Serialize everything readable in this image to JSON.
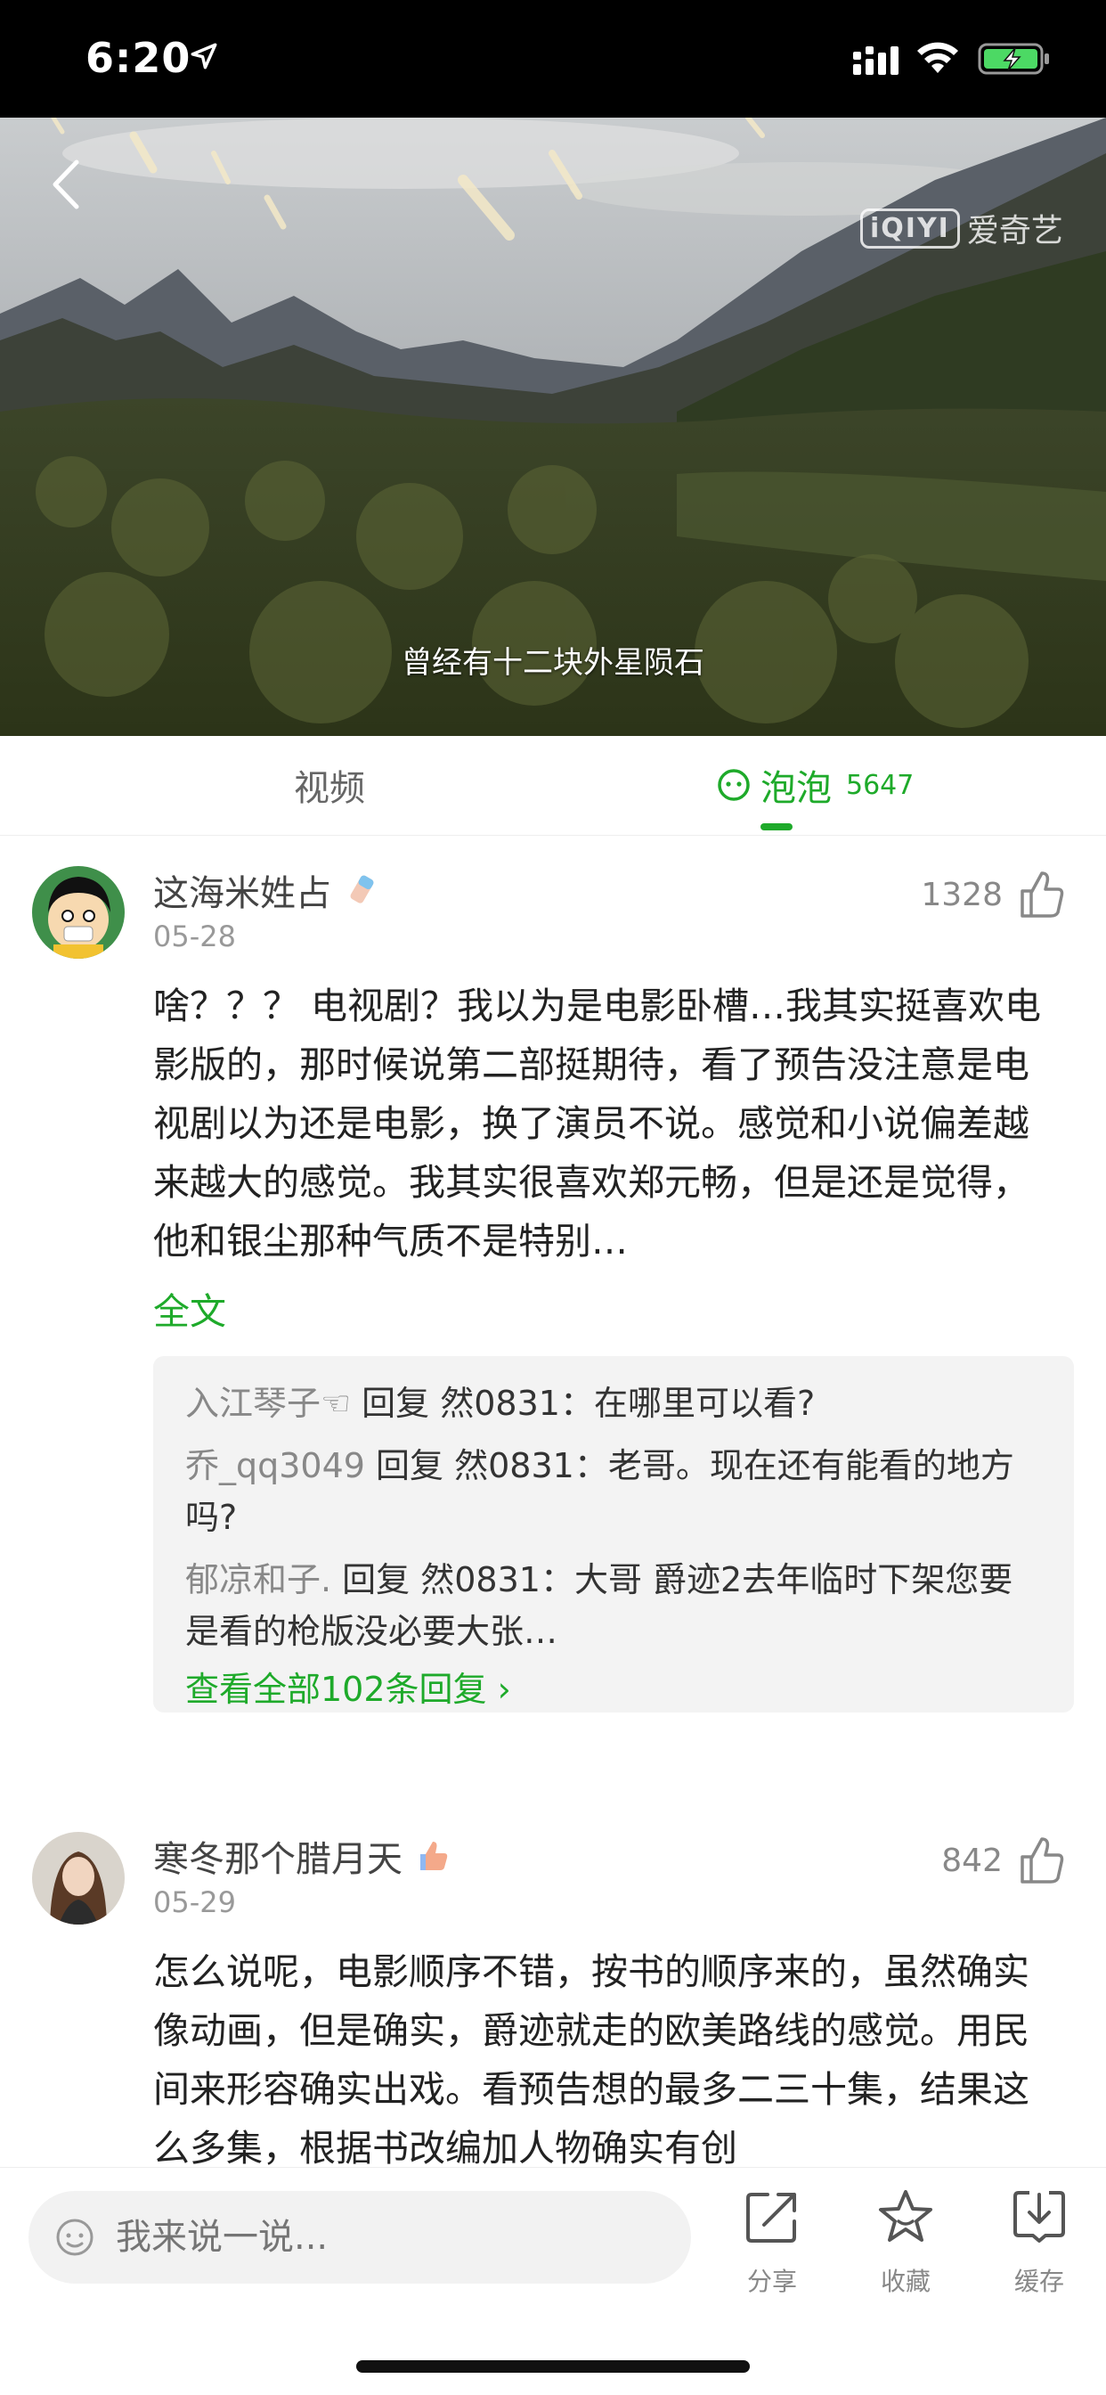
{
  "status": {
    "time": "6:20"
  },
  "video": {
    "logo_mark": "iQIYI",
    "logo_text": "爱奇艺",
    "subtitle": "曾经有十二块外星陨石"
  },
  "tabs": {
    "video_label": "视频",
    "bubble_label": "泡泡",
    "bubble_count": "5647"
  },
  "comments": [
    {
      "username": "这海米姓占",
      "date": "05-28",
      "likes": "1328",
      "text": "啥？？？ 电视剧？我以为是电影卧槽…我其实挺喜欢电影版的，那时候说第二部挺期待，看了预告没注意是电视剧以为还是电影，换了演员不说。感觉和小说偏差越来越大的感觉。我其实很喜欢郑元畅，但是还是觉得，他和银尘那种气质不是特别…",
      "full_label": "全文",
      "replies": [
        {
          "name": "入江琴子☜",
          "text": " 回复 然0831：在哪里可以看?"
        },
        {
          "name": "乔_qq3049",
          "text": " 回复 然0831：老哥。现在还有能看的地方吗?"
        },
        {
          "name": "郁凉和子.",
          "text": " 回复 然0831：大哥 爵迹2去年临时下架您要是看的枪版没必要大张…"
        }
      ],
      "more_replies": "查看全部102条回复 ›"
    },
    {
      "username": "寒冬那个腊月天",
      "date": "05-29",
      "likes": "842",
      "text": "怎么说呢，电影顺序不错，按书的顺序来的，虽然确实像动画，但是确实，爵迹就走的欧美路线的感觉。用民间来形容确实出戏。看预告想的最多二三十集，结果这么多集，根据书改编加人物确实有创"
    }
  ],
  "bottom": {
    "input_placeholder": "我来说一说...",
    "share_label": "分享",
    "favorite_label": "收藏",
    "cache_label": "缓存"
  },
  "colors": {
    "accent": "#1eaa2a",
    "status_bar": "#000000",
    "reply_bg": "#f3f3f3"
  },
  "icons": [
    "location-arrow-icon",
    "signal-icon",
    "wifi-icon",
    "battery-icon",
    "back-icon",
    "bubble-face-icon",
    "thumb-up-icon",
    "smile-icon",
    "share-icon",
    "star-icon",
    "download-icon"
  ]
}
